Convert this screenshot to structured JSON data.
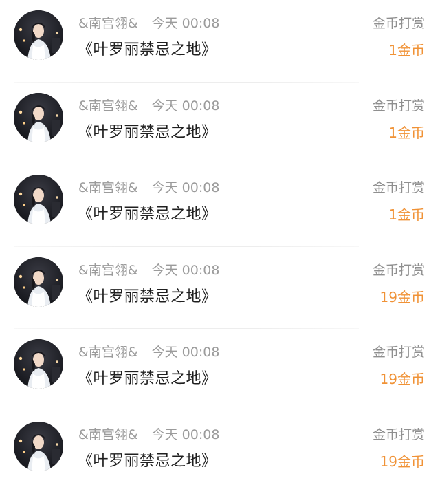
{
  "rewards": [
    {
      "username": "&南宫翎&",
      "time": "今天 00:08",
      "book_title": "《叶罗丽禁忌之地》",
      "action": "金币打赏",
      "amount": "1金币"
    },
    {
      "username": "&南宫翎&",
      "time": "今天 00:08",
      "book_title": "《叶罗丽禁忌之地》",
      "action": "金币打赏",
      "amount": "1金币"
    },
    {
      "username": "&南宫翎&",
      "time": "今天 00:08",
      "book_title": "《叶罗丽禁忌之地》",
      "action": "金币打赏",
      "amount": "1金币"
    },
    {
      "username": "&南宫翎&",
      "time": "今天 00:08",
      "book_title": "《叶罗丽禁忌之地》",
      "action": "金币打赏",
      "amount": "19金币"
    },
    {
      "username": "&南宫翎&",
      "time": "今天 00:08",
      "book_title": "《叶罗丽禁忌之地》",
      "action": "金币打赏",
      "amount": "19金币"
    },
    {
      "username": "&南宫翎&",
      "time": "今天 00:08",
      "book_title": "《叶罗丽禁忌之地》",
      "action": "金币打赏",
      "amount": "19金币"
    }
  ],
  "colors": {
    "amount": "#f09236",
    "meta": "#9b9b9b",
    "title": "#1f1f1f"
  }
}
